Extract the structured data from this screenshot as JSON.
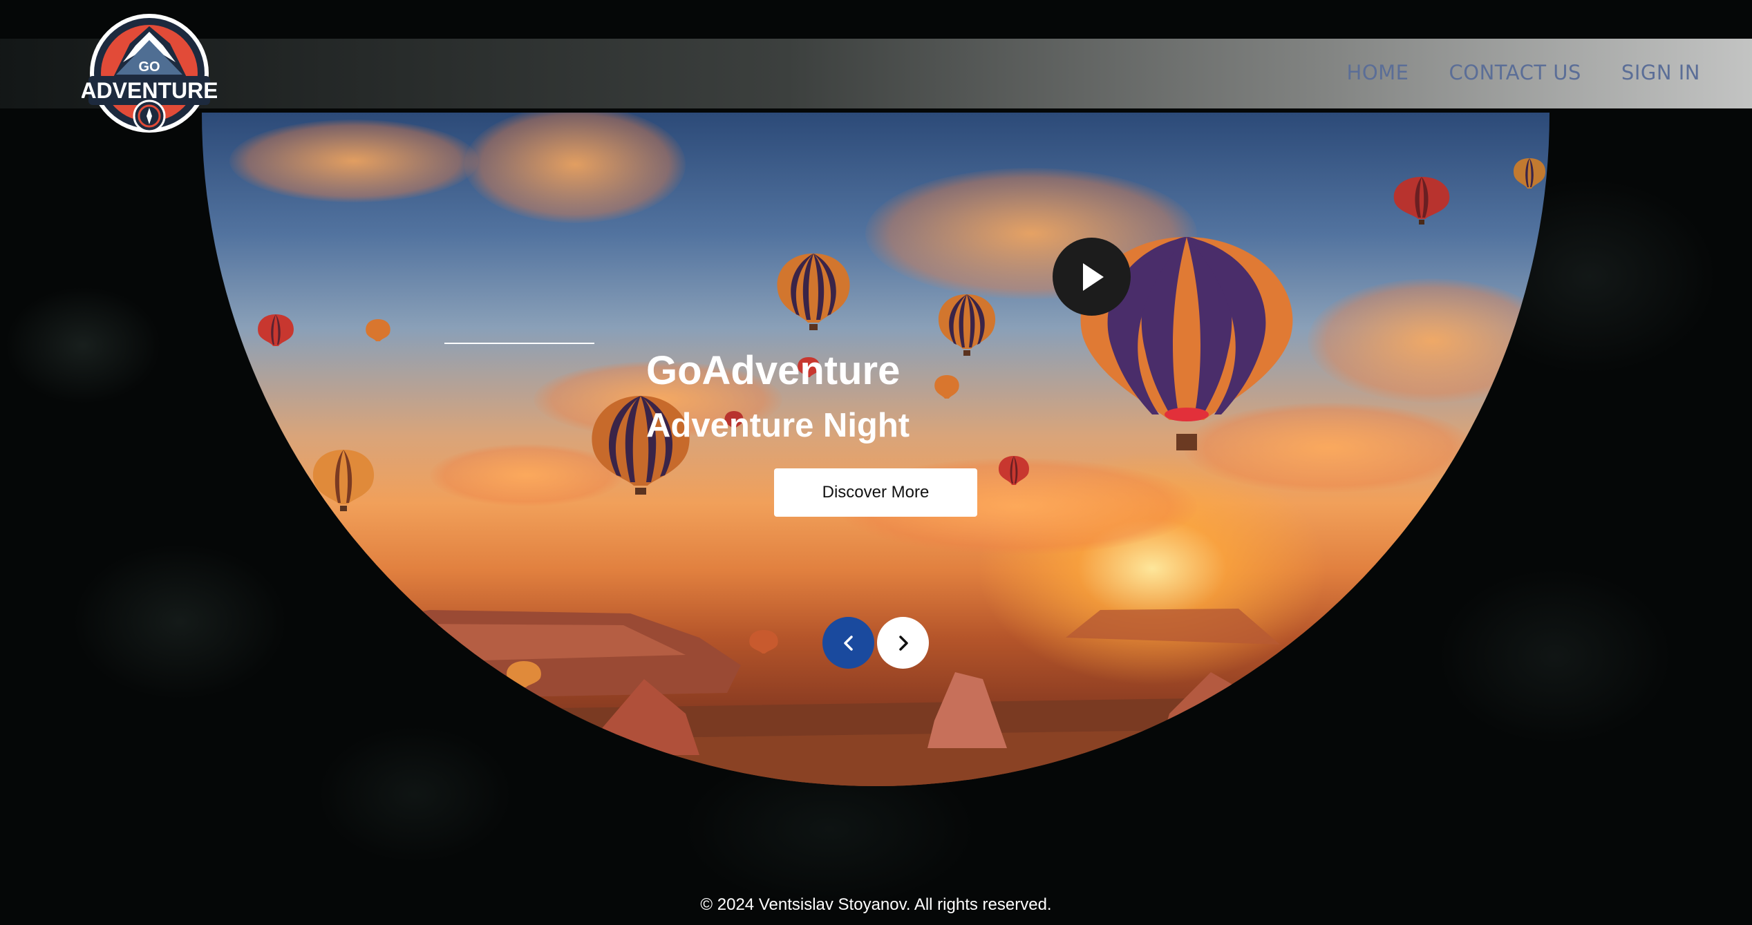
{
  "logo": {
    "top_text": "GO",
    "main_text": "ADVENTURE"
  },
  "nav": {
    "home": "HOME",
    "contact": "CONTACT US",
    "signin": "SIGN IN"
  },
  "hero": {
    "title": "GoAdventure",
    "subtitle": "Adventure Night",
    "cta_label": "Discover More",
    "play_icon": "play-icon",
    "prev_icon": "chevron-left-icon",
    "next_icon": "chevron-right-icon"
  },
  "footer": {
    "text": "© 2024 Ventsislav Stoyanov. All rights reserved."
  },
  "colors": {
    "nav_text": "#5b6e97",
    "prev_button": "#1a4a9e",
    "next_button": "#ffffff"
  }
}
